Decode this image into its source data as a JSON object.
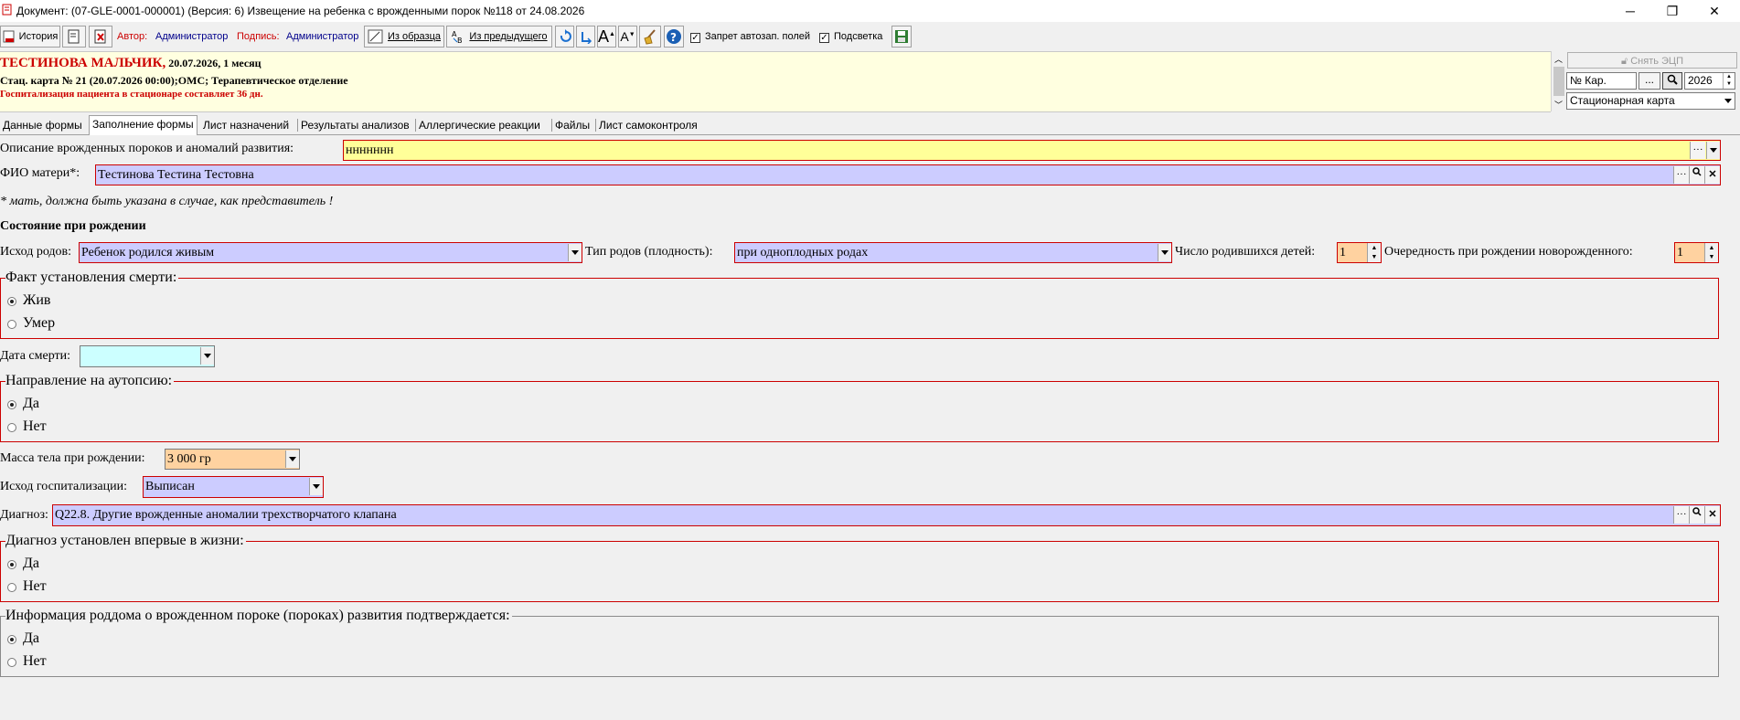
{
  "window": {
    "title": "Документ: (07-GLE-0001-000001) (Версия: 6) Извещение на ребенка с врожденными порок №118 от 24.08.2026",
    "minimize_icon": "minimize-icon",
    "maximize_icon": "restore-icon",
    "close_icon": "close-icon"
  },
  "toolbar": {
    "history_label": "История",
    "author_label": "Автор:",
    "author_value": "Администратор",
    "signature_label": "Подпись:",
    "signature_value": "Администратор",
    "from_sample_label": "Из образца",
    "from_previous_label": "Из предыдущего",
    "autofill_ban_label": "Запрет автозап. полей",
    "highlight_label": "Подсветка",
    "help_icon": "?"
  },
  "header": {
    "patient_name": "ТЕСТИНОВА МАЛЬЧИК,",
    "patient_info": " 20.07.2026, 1 месяц",
    "card_info": "Стац. карта  № 21 (20.07.2026 00:00);ОМС; Терапевтическое отделение",
    "hospitalization_note": "Госпитализация пациента в стационаре составляет 36 дн."
  },
  "right_panel": {
    "remove_eds_label": "Снять ЭЦП",
    "card_number_placeholder": "№ Кар.",
    "ellipsis": "...",
    "year": "2026",
    "card_type": "Стационарная карта"
  },
  "tabs": [
    {
      "label": "Данные формы"
    },
    {
      "label": "Заполнение формы"
    },
    {
      "label": "Лист назначений"
    },
    {
      "label": "Результаты анализов"
    },
    {
      "label": "Аллергические реакции"
    },
    {
      "label": "Файлы"
    },
    {
      "label": "Лист самоконтроля"
    }
  ],
  "form": {
    "anomalies_label": "Описание врожденных пороков и аномалий развития:",
    "anomalies_value": "ннннннн",
    "mother_label": "ФИО матери*:",
    "mother_value": "Тестинова Тестина Тестовна",
    "mother_note": "* мать, должна быть указана в случае, как представитель !",
    "birth_state_heading": "Состояние при рождении",
    "birth_outcome_label": "Исход родов:",
    "birth_outcome_value": "Ребенок родился живым",
    "birth_type_label": "Тип родов (плодность):",
    "birth_type_value": "при одноплодных родах",
    "children_count_label": "Число родившихся детей:",
    "children_count_value": "1",
    "birth_order_label": "Очередность при рождении новорожденного:",
    "birth_order_value": "1",
    "death_fact_title": "Факт установления смерти:",
    "death_fact_options": [
      "Жив",
      "Умер"
    ],
    "death_fact_selected": "Жив",
    "death_date_label": "Дата смерти:",
    "death_date_value": "",
    "autopsy_title": "Направление на аутопсию:",
    "autopsy_options": [
      "Да",
      "Нет"
    ],
    "autopsy_selected": "Да",
    "birth_weight_label": "Масса тела при рождении:",
    "birth_weight_value": "3 000 гр",
    "hosp_outcome_label": "Исход госпитализации:",
    "hosp_outcome_value": "Выписан",
    "diagnosis_label": "Диагноз:",
    "diagnosis_value": "Q22.8. Другие врожденные аномалии трехстворчатого клапана",
    "first_diagnosis_title": "Диагноз установлен впервые в жизни:",
    "first_diagnosis_options": [
      "Да",
      "Нет"
    ],
    "first_diagnosis_selected": "Да",
    "maternity_info_title": "Информация роддома о врожденном пороке (пороках) развития подтверждается:",
    "maternity_info_options": [
      "Да",
      "Нет"
    ],
    "maternity_info_selected": "Да",
    "ellipsis": "···"
  },
  "colors": {
    "required_border": "#cc0000",
    "field_lavender": "#ccccff",
    "field_yellow": "#ffff99",
    "field_orange": "#ffd2a0",
    "field_cyan": "#ccffff",
    "header_bg": "#ffffe0",
    "header_red": "#cc0000",
    "author_blue": "#00008b"
  }
}
